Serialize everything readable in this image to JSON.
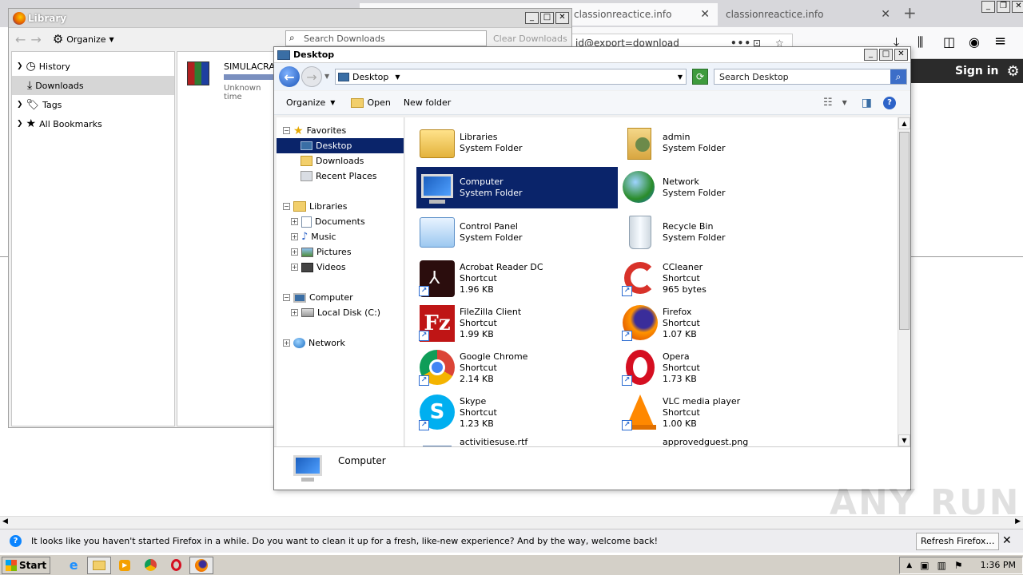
{
  "firefox": {
    "tab1": "classionreactice.info",
    "tab2": "classionreactice.info",
    "url_fragment": "id@export=download",
    "sign_in": "Sign in",
    "notification": "It looks like you haven't started Firefox in a while. Do you want to clean it up for a fresh, like-new experience? And by the way, welcome back!",
    "refresh_button": "Refresh Firefox…"
  },
  "library": {
    "title": "Library",
    "organize": "Organize",
    "search_placeholder": "Search Downloads",
    "clear_downloads": "Clear Downloads",
    "nav": [
      {
        "label": "History",
        "icon": "clock-icon"
      },
      {
        "label": "Downloads",
        "icon": "download-arrow-icon"
      },
      {
        "label": "Tags",
        "icon": "tag-icon"
      },
      {
        "label": "All Bookmarks",
        "icon": "star-icon"
      }
    ],
    "download": {
      "name": "SIMULACRA.r",
      "status": "Unknown time"
    }
  },
  "explorer": {
    "title": "Desktop",
    "breadcrumb": "Desktop",
    "search_placeholder": "Search Desktop",
    "commands": {
      "organize": "Organize",
      "open": "Open",
      "new_folder": "New folder"
    },
    "tree": {
      "favorites": "Favorites",
      "desktop": "Desktop",
      "downloads": "Downloads",
      "recent": "Recent Places",
      "libraries": "Libraries",
      "documents": "Documents",
      "music": "Music",
      "pictures": "Pictures",
      "videos": "Videos",
      "computer": "Computer",
      "local_disk": "Local Disk (C:)",
      "network": "Network"
    },
    "items": [
      {
        "name": "Libraries",
        "type": "System Folder",
        "size": ""
      },
      {
        "name": "admin",
        "type": "System Folder",
        "size": ""
      },
      {
        "name": "Computer",
        "type": "System Folder",
        "size": ""
      },
      {
        "name": "Network",
        "type": "System Folder",
        "size": ""
      },
      {
        "name": "Control Panel",
        "type": "System Folder",
        "size": ""
      },
      {
        "name": "Recycle Bin",
        "type": "System Folder",
        "size": ""
      },
      {
        "name": "Acrobat Reader DC",
        "type": "Shortcut",
        "size": "1.96 KB"
      },
      {
        "name": "CCleaner",
        "type": "Shortcut",
        "size": "965 bytes"
      },
      {
        "name": "FileZilla Client",
        "type": "Shortcut",
        "size": "1.99 KB"
      },
      {
        "name": "Firefox",
        "type": "Shortcut",
        "size": "1.07 KB"
      },
      {
        "name": "Google Chrome",
        "type": "Shortcut",
        "size": "2.14 KB"
      },
      {
        "name": "Opera",
        "type": "Shortcut",
        "size": "1.73 KB"
      },
      {
        "name": "Skype",
        "type": "Shortcut",
        "size": "1.23 KB"
      },
      {
        "name": "VLC media player",
        "type": "Shortcut",
        "size": "1.00 KB"
      },
      {
        "name": "activitiesuse.rtf",
        "type": "",
        "size": ""
      },
      {
        "name": "approvedguest.png",
        "type": "",
        "size": ""
      }
    ],
    "details_name": "Computer"
  },
  "taskbar": {
    "start": "Start",
    "clock": "1:36 PM"
  },
  "watermark": "ANY RUN"
}
